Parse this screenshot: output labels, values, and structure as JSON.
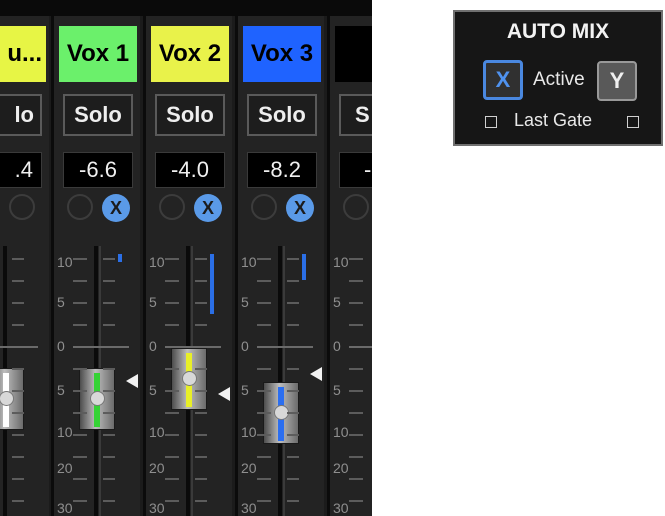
{
  "channels": [
    {
      "name": "u...",
      "name_bg": "#e7f545",
      "name_color": "#000000",
      "solo": "lo",
      "gain": ".4",
      "has_x": false,
      "fader_stripe": "#ffffff"
    },
    {
      "name": "Vox 1",
      "name_bg": "#6bf06b",
      "name_color": "#000000",
      "solo": "Solo",
      "gain": "-6.6",
      "has_x": true,
      "fader_stripe": "#35d335"
    },
    {
      "name": "Vox 2",
      "name_bg": "#e9f24a",
      "name_color": "#000000",
      "solo": "Solo",
      "gain": "-4.0",
      "has_x": true,
      "fader_stripe": "#e8ef28"
    },
    {
      "name": "Vox 3",
      "name_bg": "#1f63ff",
      "name_color": "#000000",
      "solo": "Solo",
      "gain": "-8.2",
      "has_x": true,
      "fader_stripe": "#2b6ef0"
    },
    {
      "name": "",
      "name_bg": "#000000",
      "name_color": "#ffffff",
      "solo": "S",
      "gain": "-",
      "has_x": false,
      "fader_stripe": "#ffffff"
    }
  ],
  "x_badge_label": "X",
  "scale_labels": [
    "10",
    "5",
    "0",
    "5",
    "10",
    "20",
    "30"
  ],
  "automix": {
    "title": "AUTO MIX",
    "x_label": "X",
    "active_label": "Active",
    "y_label": "Y",
    "last_gate_label": "Last Gate"
  }
}
